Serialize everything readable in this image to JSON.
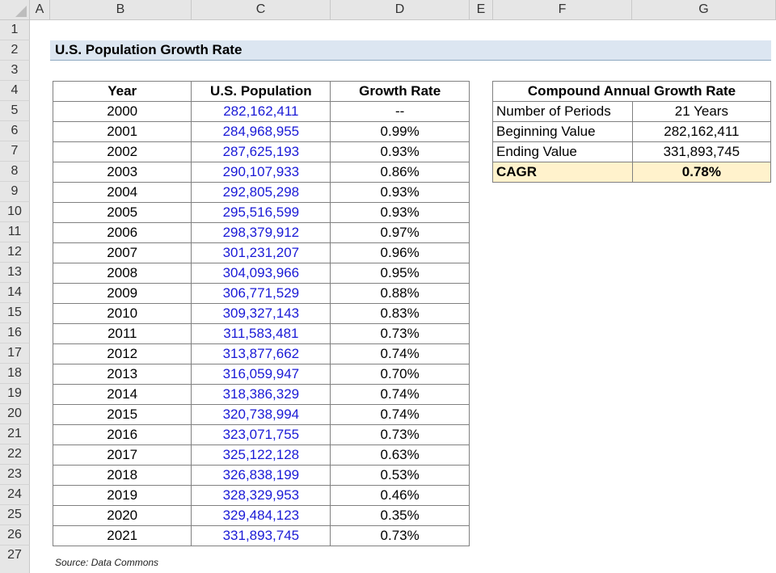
{
  "sheet": {
    "columns": [
      "A",
      "B",
      "C",
      "D",
      "E",
      "F",
      "G"
    ],
    "rows": [
      "1",
      "2",
      "3",
      "4",
      "5",
      "6",
      "7",
      "8",
      "9",
      "10",
      "11",
      "12",
      "13",
      "14",
      "15",
      "16",
      "17",
      "18",
      "19",
      "20",
      "21",
      "22",
      "23",
      "24",
      "25",
      "26",
      "27"
    ]
  },
  "title": "U.S. Population Growth Rate",
  "population_table": {
    "headers": [
      "Year",
      "U.S. Population",
      "Growth Rate"
    ],
    "rows": [
      [
        "2000",
        "282,162,411",
        "--"
      ],
      [
        "2001",
        "284,968,955",
        "0.99%"
      ],
      [
        "2002",
        "287,625,193",
        "0.93%"
      ],
      [
        "2003",
        "290,107,933",
        "0.86%"
      ],
      [
        "2004",
        "292,805,298",
        "0.93%"
      ],
      [
        "2005",
        "295,516,599",
        "0.93%"
      ],
      [
        "2006",
        "298,379,912",
        "0.97%"
      ],
      [
        "2007",
        "301,231,207",
        "0.96%"
      ],
      [
        "2008",
        "304,093,966",
        "0.95%"
      ],
      [
        "2009",
        "306,771,529",
        "0.88%"
      ],
      [
        "2010",
        "309,327,143",
        "0.83%"
      ],
      [
        "2011",
        "311,583,481",
        "0.73%"
      ],
      [
        "2012",
        "313,877,662",
        "0.74%"
      ],
      [
        "2013",
        "316,059,947",
        "0.70%"
      ],
      [
        "2014",
        "318,386,329",
        "0.74%"
      ],
      [
        "2015",
        "320,738,994",
        "0.74%"
      ],
      [
        "2016",
        "323,071,755",
        "0.73%"
      ],
      [
        "2017",
        "325,122,128",
        "0.63%"
      ],
      [
        "2018",
        "326,838,199",
        "0.53%"
      ],
      [
        "2019",
        "328,329,953",
        "0.46%"
      ],
      [
        "2020",
        "329,484,123",
        "0.35%"
      ],
      [
        "2021",
        "331,893,745",
        "0.73%"
      ]
    ]
  },
  "cagr_table": {
    "header": "Compound Annual Growth Rate",
    "number_of_periods_label": "Number of Periods",
    "number_of_periods_value": "21 Years",
    "beginning_value_label": "Beginning Value",
    "beginning_value": "282,162,411",
    "ending_value_label": "Ending Value",
    "ending_value": "331,893,745",
    "cagr_label": "CAGR",
    "cagr_value": "0.78%"
  },
  "source": "Source: Data Commons",
  "colors": {
    "title_band": "#dce6f1",
    "input_blue": "#1a1ad6",
    "highlight_yellow": "#fff2cc"
  }
}
